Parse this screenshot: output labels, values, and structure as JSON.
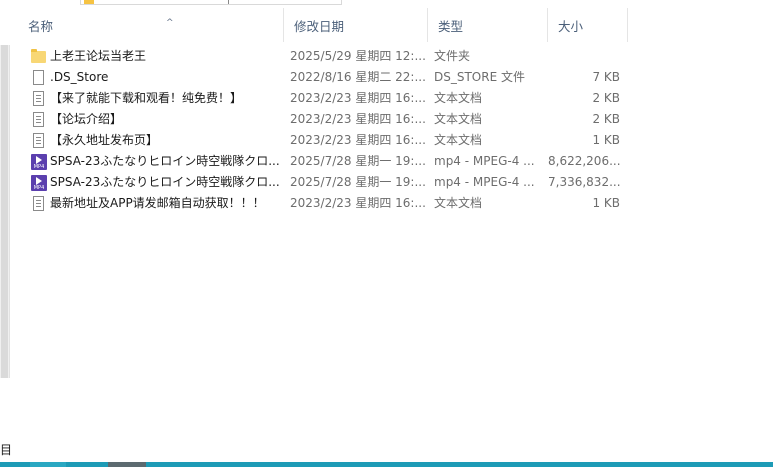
{
  "columns": {
    "name": "名称",
    "date": "修改日期",
    "type": "类型",
    "size": "大小"
  },
  "files": [
    {
      "icon": "folder-icon",
      "name": "上老王论坛当老王",
      "date": "2025/5/29 星期四 12:...",
      "type": "文件夹",
      "size": ""
    },
    {
      "icon": "file-icon",
      "name": ".DS_Store",
      "date": "2022/8/16 星期二 22:...",
      "type": "DS_STORE 文件",
      "size": "7 KB"
    },
    {
      "icon": "text-file-icon",
      "name": "【来了就能下载和观看！纯免费！】",
      "date": "2023/2/23 星期四 16:...",
      "type": "文本文档",
      "size": "2 KB"
    },
    {
      "icon": "text-file-icon",
      "name": "【论坛介绍】",
      "date": "2023/2/23 星期四 16:...",
      "type": "文本文档",
      "size": "2 KB"
    },
    {
      "icon": "text-file-icon",
      "name": "【永久地址发布页】",
      "date": "2023/2/23 星期四 16:...",
      "type": "文本文档",
      "size": "1 KB"
    },
    {
      "icon": "mp4-file-icon",
      "name": "SPSA-23ふたなりヒロイン時空戦隊クロ...",
      "date": "2025/7/28 星期一 19:...",
      "type": "mp4 - MPEG-4 ...",
      "size": "8,622,206..."
    },
    {
      "icon": "mp4-file-icon",
      "name": "SPSA-23ふたなりヒロイン時空戦隊クロ...",
      "date": "2025/7/28 星期一 19:...",
      "type": "mp4 - MPEG-4 ...",
      "size": "7,336,832..."
    },
    {
      "icon": "text-file-icon",
      "name": "最新地址及APP请发邮箱自动获取！！！",
      "date": "2023/2/23 星期四 16:...",
      "type": "文本文档",
      "size": "1 KB"
    }
  ],
  "status_fragment": "目",
  "mp4_badge": "MP4"
}
